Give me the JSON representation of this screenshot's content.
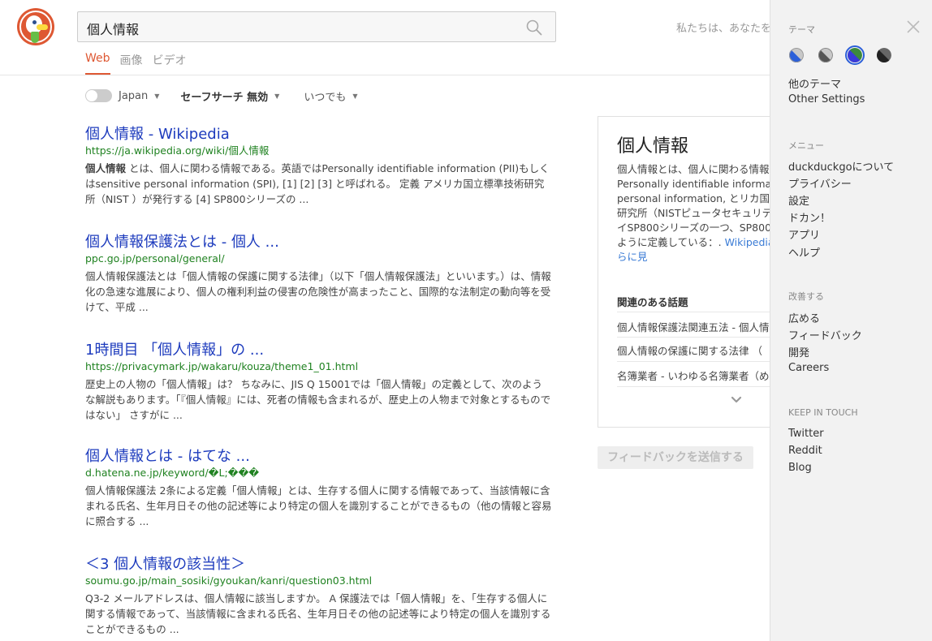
{
  "search": {
    "query": "個人情報"
  },
  "header": {
    "tagline": "私たちは、あなたを"
  },
  "tabs": [
    {
      "label": "Web",
      "active": true
    },
    {
      "label": "画像",
      "active": false
    },
    {
      "label": "ビデオ",
      "active": false
    }
  ],
  "filters": {
    "region": "Japan",
    "safesearch": "セーフサーチ 無効",
    "time": "いつでも"
  },
  "results": [
    {
      "title": "個人情報 - Wikipedia",
      "url": "https://ja.wikipedia.org/wiki/個人情報",
      "snippet_bold": "個人情報",
      "snippet": " とは、個人に関わる情報である。英語ではPersonally identifiable information (PII)もしくはsensitive personal information (SPI), [1] [2] [3] と呼ばれる。 定義 アメリカ国立標準技術研究所（NIST ）が発行する [4] SP800シリーズの ..."
    },
    {
      "title": "個人情報保護法とは - 個人 ...",
      "url": "ppc.go.jp/personal/general/",
      "snippet_bold": "",
      "snippet": "個人情報保護法とは「個人情報の保護に関する法律」（以下「個人情報保護法」といいます。）は、情報化の急速な進展により、個人の権利利益の侵害の危険性が高まったこと、国際的な法制定の動向等を受けて、平成 ..."
    },
    {
      "title": "1時間目 「個人情報」の ...",
      "url": "https://privacymark.jp/wakaru/kouza/theme1_01.html",
      "snippet_bold": "",
      "snippet": "歴史上の人物の「個人情報」は？ ちなみに、JIS Q 15001では「個人情報」の定義として、次のような解説もあります。「『個人情報』には、死者の情報も含まれるが、歴史上の人物まで対象とするものではない」 さすがに ..."
    },
    {
      "title": "個人情報とは - はてな ...",
      "url": "d.hatena.ne.jp/keyword/�L;���",
      "snippet_bold": "",
      "snippet": "個人情報保護法 2条による定義「個人情報」とは、生存する個人に関する情報であって、当該情報に含まれる氏名、生年月日その他の記述等により特定の個人を識別することができるもの（他の情報と容易に照合する ..."
    },
    {
      "title": "＜3 個人情報の該当性＞",
      "url": "soumu.go.jp/main_sosiki/gyoukan/kanri/question03.html",
      "snippet_bold": "",
      "snippet": "Q3-2 メールアドレスは、個人情報に該当しますか。 A 保護法では「個人情報」を、「生存する個人に関する情報であって、当該情報に含まれる氏名、生年月日その他の記述等により特定の個人を識別することができるもの ..."
    }
  ],
  "knowledge_panel": {
    "title": "個人情報",
    "abstract": "個人情報とは、個人に関わる情報はPersonally identifiable informasensitive personal information, とリカ国立標準技術研究所（NISTピュータセキュリティ関連のガイSP800シリーズの一つ、SP800-報を以下のように定義している：.",
    "more_link": "Wikipedia (JA) でさらに見",
    "related_heading": "関連のある話題",
    "related": [
      "個人情報保護法関連五法 - 個人情",
      "個人情報の保護に関する法律 （",
      "名簿業者 - いわゆる名簿業者（め"
    ]
  },
  "feedback_button": "フィードバックを送信する",
  "drawer": {
    "theme_heading": "テーマ",
    "theme_swatches": [
      "#2b5fd9",
      "#555555",
      "#3c8a3c",
      "#222222"
    ],
    "more_themes": "他のテーマ",
    "other_settings": "Other Settings",
    "menu_heading": "メニュー",
    "menu_items": [
      "duckduckgoについて",
      "プライバシー",
      "設定",
      "ドカン！",
      "アプリ",
      "ヘルプ"
    ],
    "improve_heading": "改善する",
    "improve_items": [
      "広める",
      "フィードバック",
      "開発",
      "Careers"
    ],
    "touch_heading": "KEEP IN TOUCH",
    "touch_items": [
      "Twitter",
      "Reddit",
      "Blog"
    ]
  }
}
